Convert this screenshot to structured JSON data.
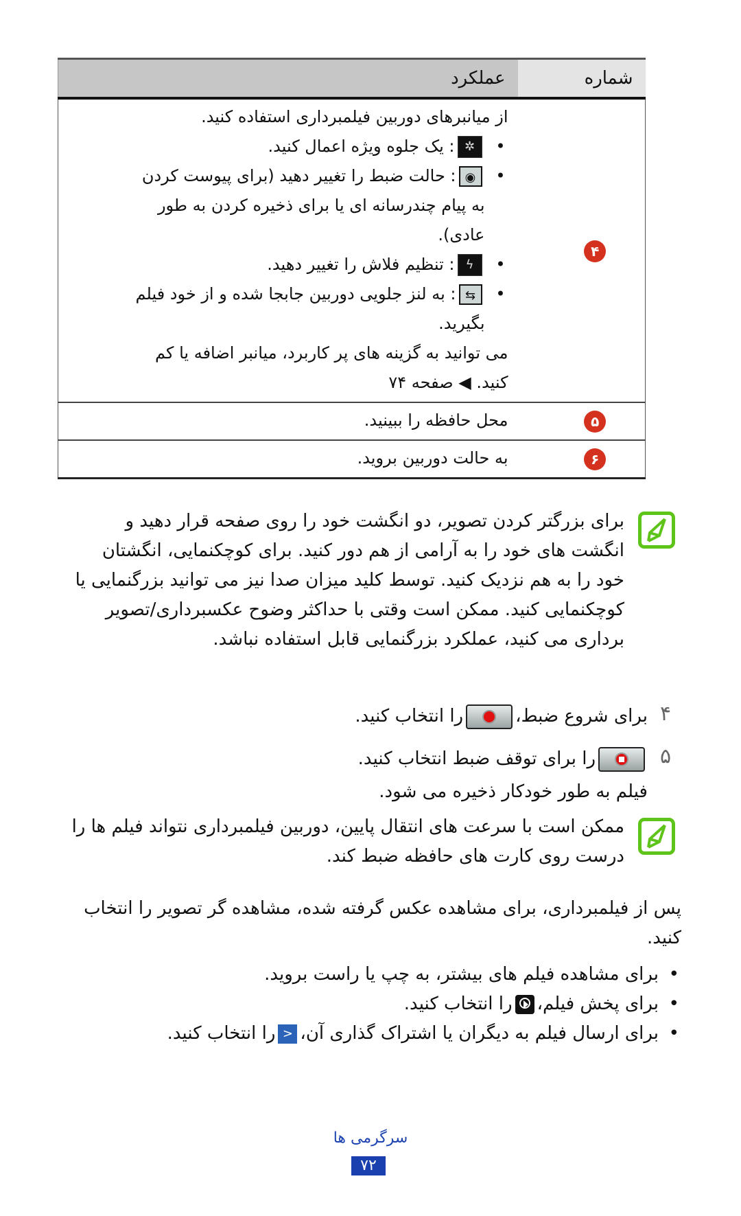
{
  "table": {
    "headers": {
      "number": "شماره",
      "function": "عملکرد"
    },
    "row4": {
      "badge": "۴",
      "intro": "از میانبرهای دوربین فیلمبرداری استفاده کنید.",
      "items": [
        {
          "icon": "effect-wand-icon",
          "text": ": یک جلوه ویژه اعمال کنید."
        },
        {
          "icon": "recording-mode-icon",
          "text": ": حالت ضبط را تغییر دهید (برای پیوست کردن به پیام چندرسانه ای یا برای ذخیره کردن به طور عادی)."
        },
        {
          "icon": "flash-off-icon",
          "text": ": تنظیم فلاش را تغییر دهید."
        },
        {
          "icon": "switch-camera-icon",
          "text": ": به لنز جلویی دوربین جابجا شده و از خود فیلم بگیرید."
        }
      ],
      "outro": "می توانید به گزینه های پر کاربرد، میانبر اضافه یا کم کنید.",
      "page_ref_arrow": "◀",
      "page_ref": "صفحه ۷۴"
    },
    "row5": {
      "badge": "۵",
      "text": "محل حافظه را ببینید."
    },
    "row6": {
      "badge": "۶",
      "text": "به حالت دوربین بروید."
    }
  },
  "note1": "برای بزرگتر کردن تصویر، دو انگشت خود را روی صفحه قرار دهید و انگشت های خود را به آرامی از هم دور کنید. برای کوچکنمایی، انگشتان خود را به هم نزدیک کنید. توسط کلید میزان صدا نیز می توانید بزرگنمایی یا کوچکنمایی کنید. ممکن است وقتی با حداکثر وضوح عکسبرداری/تصویر برداری می کنید، عملکرد بزرگنمایی قابل استفاده نباشد.",
  "steps": [
    {
      "number": "۴",
      "before": "برای شروع ضبط،",
      "after": "را انتخاب کنید."
    },
    {
      "number": "۵",
      "before": "",
      "after": "را برای توقف ضبط انتخاب کنید."
    }
  ],
  "auto_save": "فیلم به طور خودکار ذخیره می شود.",
  "note2": "ممکن است با سرعت های انتقال پایین، دوربین فیلمبرداری نتواند فیلم ها را درست روی کارت های حافظه ضبط کند.",
  "after_para": "پس از فیلمبرداری، برای مشاهده عکس گرفته شده، مشاهده گر تصویر را انتخاب کنید.",
  "bullets": [
    {
      "before": "برای مشاهده فیلم های بیشتر، به چپ یا راست بروید.",
      "after": ""
    },
    {
      "before": "برای پخش فیلم،",
      "after": "را انتخاب کنید.",
      "icon": "play-icon"
    },
    {
      "before": "برای ارسال فیلم به دیگران یا اشتراک گذاری آن،",
      "after": "را انتخاب کنید.",
      "icon": "share-icon"
    }
  ],
  "footer": {
    "section": "سرگرمی ها",
    "page": "۷۲"
  },
  "colors": {
    "badge": "#d5311f",
    "note_icon": "#5fc41a",
    "footer": "#1a3fae"
  }
}
